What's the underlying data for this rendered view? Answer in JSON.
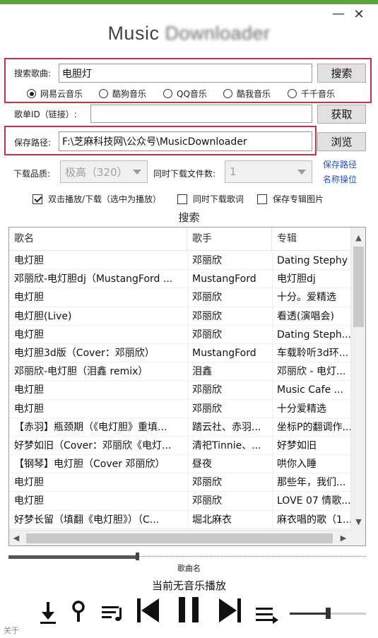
{
  "window": {
    "title_visible": "Music",
    "title_blurred": "Downloader",
    "minimize_glyph": "—",
    "close_glyph": "✕"
  },
  "search": {
    "label": "搜索歌曲:",
    "value": "电胆灯",
    "button": "搜索",
    "sources": [
      {
        "label": "网易云音乐",
        "selected": true
      },
      {
        "label": "酷狗音乐",
        "selected": false
      },
      {
        "label": "QQ音乐",
        "selected": false
      },
      {
        "label": "酷我音乐",
        "selected": false
      },
      {
        "label": "千千音乐",
        "selected": false
      }
    ]
  },
  "playlist": {
    "label": "歌单ID（链接）:",
    "value": "",
    "button": "获取"
  },
  "save": {
    "label": "保存路径:",
    "value": "F:\\芝麻科技网\\公众号\\MusicDownloader",
    "button": "浏览"
  },
  "options": {
    "quality_label": "下载品质:",
    "quality_value": "极高（320）",
    "concurrent_label": "同时下载文件数:",
    "concurrent_value": "1",
    "link_line1": "保存路径",
    "link_line2": "名称操位",
    "checkboxes": [
      {
        "label": "双击播放/下载（选中为播放）",
        "checked": true
      },
      {
        "label": "同时下载歌词",
        "checked": false
      },
      {
        "label": "保存专辑图片",
        "checked": false
      }
    ]
  },
  "results": {
    "title": "搜索",
    "columns": [
      "歌名",
      "歌手",
      "专辑"
    ],
    "rows": [
      [
        "电灯胆",
        "邓丽欣",
        "Dating Stephy"
      ],
      [
        "邓丽欣-电灯胆dj（MustangFord ...",
        "MustangFord",
        "电灯胆dj"
      ],
      [
        "电灯胆",
        "邓丽欣",
        "十分。爱精选"
      ],
      [
        "电灯胆(Live)",
        "邓丽欣",
        "看透(演唱会)"
      ],
      [
        "电灯胆",
        "邓丽欣",
        "Dating Steph..."
      ],
      [
        "电灯胆3d版（Cover：邓丽欣）",
        "MustangFord",
        "车载聆听3d环..."
      ],
      [
        "邓丽欣-电灯胆（泪鑫 remix）",
        "泪鑫",
        "邓丽欣 - 电灯..."
      ],
      [
        "电灯胆",
        "邓丽欣",
        "Music Cafe ..."
      ],
      [
        "电灯胆",
        "邓丽欣",
        "十分爱精选"
      ],
      [
        "【赤羽】瓶颈期（《电灯胆》重填...",
        "踏云社、赤羽...",
        "坐标P的翻调作..."
      ],
      [
        "好梦如旧（Cover：邓丽欣《电灯...",
        "清祀Tinnie、...",
        "好梦如旧"
      ],
      [
        "【钢琴】电灯胆（Cover 邓丽欣）",
        "昼夜",
        "哄你入睡"
      ],
      [
        "电灯胆",
        "邓丽欣",
        "那些年，我们..."
      ],
      [
        "电灯胆",
        "邓丽欣",
        "LOVE 07 情歌..."
      ],
      [
        "好梦长留（填翻《电灯胆》）（C...",
        "堀北麻衣",
        "麻衣唱的歌（1..."
      ]
    ]
  },
  "player": {
    "song_name_label": "歌曲名",
    "status": "当前无音乐播放",
    "progress": 0.36,
    "volume": 0.5,
    "about": "关于"
  }
}
